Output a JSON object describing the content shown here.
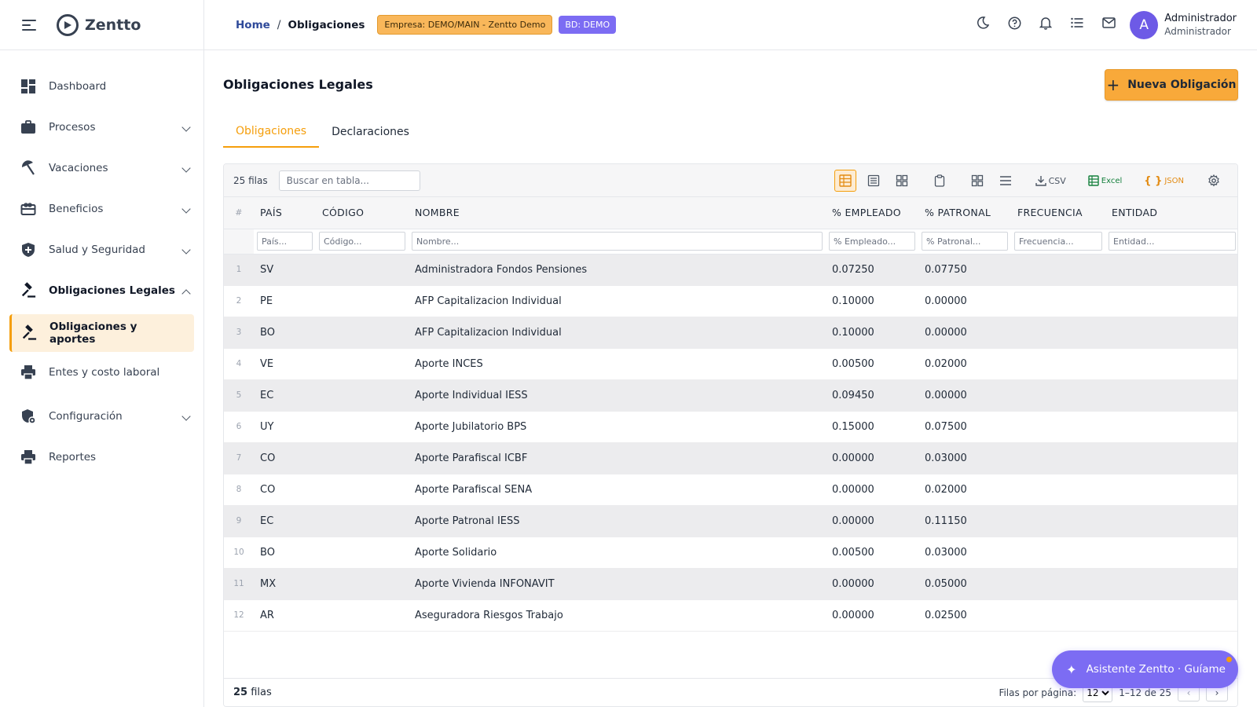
{
  "brand": {
    "name": "Zentto",
    "logo_icon": "zentto-logo-icon",
    "menu_icon": "menu-collapse-icon"
  },
  "sidebar": {
    "items": [
      {
        "label": "Dashboard",
        "icon": "dashboard-icon",
        "has_chevron": false
      },
      {
        "label": "Procesos",
        "icon": "briefcase-icon",
        "has_chevron": true
      },
      {
        "label": "Vacaciones",
        "icon": "beach-umbrella-icon",
        "has_chevron": true
      },
      {
        "label": "Beneficios",
        "icon": "gift-card-icon",
        "has_chevron": true
      },
      {
        "label": "Salud y Seguridad",
        "icon": "shield-plus-icon",
        "has_chevron": true
      },
      {
        "label": "Obligaciones Legales",
        "icon": "gavel-icon",
        "has_chevron": true,
        "expanded": true
      },
      {
        "label": "Obligaciones y aportes",
        "icon": "gavel-icon",
        "active": true
      },
      {
        "label": "Entes y costo laboral",
        "icon": "printer-icon"
      },
      {
        "label": "Configuración",
        "icon": "settings-shield-icon",
        "has_chevron": true
      },
      {
        "label": "Reportes",
        "icon": "printer-icon"
      }
    ]
  },
  "header": {
    "breadcrumb_home": "Home",
    "breadcrumb_sep": "/",
    "breadcrumb_current": "Obligaciones",
    "company_badge": "Empresa: DEMO/MAIN - Zentto Demo",
    "db_badge": "BD: DEMO",
    "icons": [
      "dark-mode-icon",
      "help-icon",
      "notifications-icon",
      "list-icon",
      "mail-icon"
    ],
    "user": {
      "initial": "A",
      "name": "Administrador",
      "role": "Administrador"
    }
  },
  "page": {
    "title": "Obligaciones Legales",
    "new_button": "Nueva Obligación",
    "tabs": [
      {
        "label": "Obligaciones",
        "active": true
      },
      {
        "label": "Declaraciones",
        "active": false
      }
    ]
  },
  "grid": {
    "row_count_label": "25 filas",
    "search_placeholder": "Buscar en tabla...",
    "toolbar": {
      "csv": "CSV",
      "excel": "Excel",
      "json": "JSON"
    },
    "columns": [
      "#",
      "PAÍS",
      "CÓDIGO",
      "NOMBRE",
      "% EMPLEADO",
      "% PATRONAL",
      "FRECUENCIA",
      "ENTIDAD"
    ],
    "filters": [
      "País...",
      "Código...",
      "Nombre...",
      "% Empleado...",
      "% Patronal...",
      "Frecuencia...",
      "Entidad..."
    ],
    "rows": [
      {
        "n": "1",
        "pais": "SV",
        "codigo": "",
        "nombre": "Administradora Fondos Pensiones",
        "empleado": "0.07250",
        "patronal": "0.07750",
        "frecuencia": "",
        "entidad": ""
      },
      {
        "n": "2",
        "pais": "PE",
        "codigo": "",
        "nombre": "AFP Capitalizacion Individual",
        "empleado": "0.10000",
        "patronal": "0.00000",
        "frecuencia": "",
        "entidad": ""
      },
      {
        "n": "3",
        "pais": "BO",
        "codigo": "",
        "nombre": "AFP Capitalizacion Individual",
        "empleado": "0.10000",
        "patronal": "0.00000",
        "frecuencia": "",
        "entidad": ""
      },
      {
        "n": "4",
        "pais": "VE",
        "codigo": "",
        "nombre": "Aporte INCES",
        "empleado": "0.00500",
        "patronal": "0.02000",
        "frecuencia": "",
        "entidad": ""
      },
      {
        "n": "5",
        "pais": "EC",
        "codigo": "",
        "nombre": "Aporte Individual IESS",
        "empleado": "0.09450",
        "patronal": "0.00000",
        "frecuencia": "",
        "entidad": ""
      },
      {
        "n": "6",
        "pais": "UY",
        "codigo": "",
        "nombre": "Aporte Jubilatorio BPS",
        "empleado": "0.15000",
        "patronal": "0.07500",
        "frecuencia": "",
        "entidad": ""
      },
      {
        "n": "7",
        "pais": "CO",
        "codigo": "",
        "nombre": "Aporte Parafiscal ICBF",
        "empleado": "0.00000",
        "patronal": "0.03000",
        "frecuencia": "",
        "entidad": ""
      },
      {
        "n": "8",
        "pais": "CO",
        "codigo": "",
        "nombre": "Aporte Parafiscal SENA",
        "empleado": "0.00000",
        "patronal": "0.02000",
        "frecuencia": "",
        "entidad": ""
      },
      {
        "n": "9",
        "pais": "EC",
        "codigo": "",
        "nombre": "Aporte Patronal IESS",
        "empleado": "0.00000",
        "patronal": "0.11150",
        "frecuencia": "",
        "entidad": ""
      },
      {
        "n": "10",
        "pais": "BO",
        "codigo": "",
        "nombre": "Aporte Solidario",
        "empleado": "0.00500",
        "patronal": "0.03000",
        "frecuencia": "",
        "entidad": ""
      },
      {
        "n": "11",
        "pais": "MX",
        "codigo": "",
        "nombre": "Aporte Vivienda INFONAVIT",
        "empleado": "0.00000",
        "patronal": "0.05000",
        "frecuencia": "",
        "entidad": ""
      },
      {
        "n": "12",
        "pais": "AR",
        "codigo": "",
        "nombre": "Aseguradora Riesgos Trabajo",
        "empleado": "0.00000",
        "patronal": "0.02500",
        "frecuencia": "",
        "entidad": ""
      }
    ],
    "footer_count": "25",
    "footer_count_suffix": "filas",
    "rows_per_page_label": "Filas por página:",
    "rows_per_page_value": "12",
    "range": "1–12 de 25",
    "prev": "‹",
    "next": "›"
  },
  "assistant": {
    "label": "Asistente Zentto · Guíame",
    "icon": "sparkle-icon"
  },
  "colors": {
    "accent": "#f59e0b",
    "primary": "#7c6cf3",
    "link": "#2f4a9a"
  }
}
